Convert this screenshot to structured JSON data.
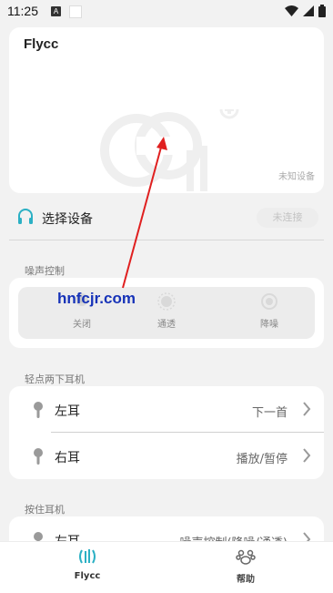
{
  "status_bar": {
    "time": "11:25",
    "notif_letter": "A"
  },
  "device": {
    "name": "Flycc",
    "state": "未知设备"
  },
  "select": {
    "label": "选择设备",
    "connect": "未连接"
  },
  "noise": {
    "title": "噪声控制",
    "options": [
      {
        "label": "关闭"
      },
      {
        "label": "通透"
      },
      {
        "label": "降噪"
      }
    ]
  },
  "tap": {
    "title": "轻点两下耳机",
    "rows": [
      {
        "ear": "左耳",
        "action": "下一首"
      },
      {
        "ear": "右耳",
        "action": "播放/暂停"
      }
    ]
  },
  "hold": {
    "title": "按住耳机",
    "rows": [
      {
        "ear": "左耳",
        "action": "噪声控制(降噪/通透)"
      }
    ]
  },
  "tabs": [
    {
      "label": "Flycc"
    },
    {
      "label": "帮助"
    }
  ],
  "watermark": "hnfcjr.com",
  "colors": {
    "accent": "#2bb0c4",
    "annotation": "#e02020",
    "watermark": "#1733b8"
  },
  "icons": [
    "wifi-icon",
    "signal-icon",
    "battery-icon",
    "headphone-icon",
    "earbud-icon",
    "chevron-right-icon",
    "tab-flycc-icon",
    "tab-help-icon"
  ]
}
